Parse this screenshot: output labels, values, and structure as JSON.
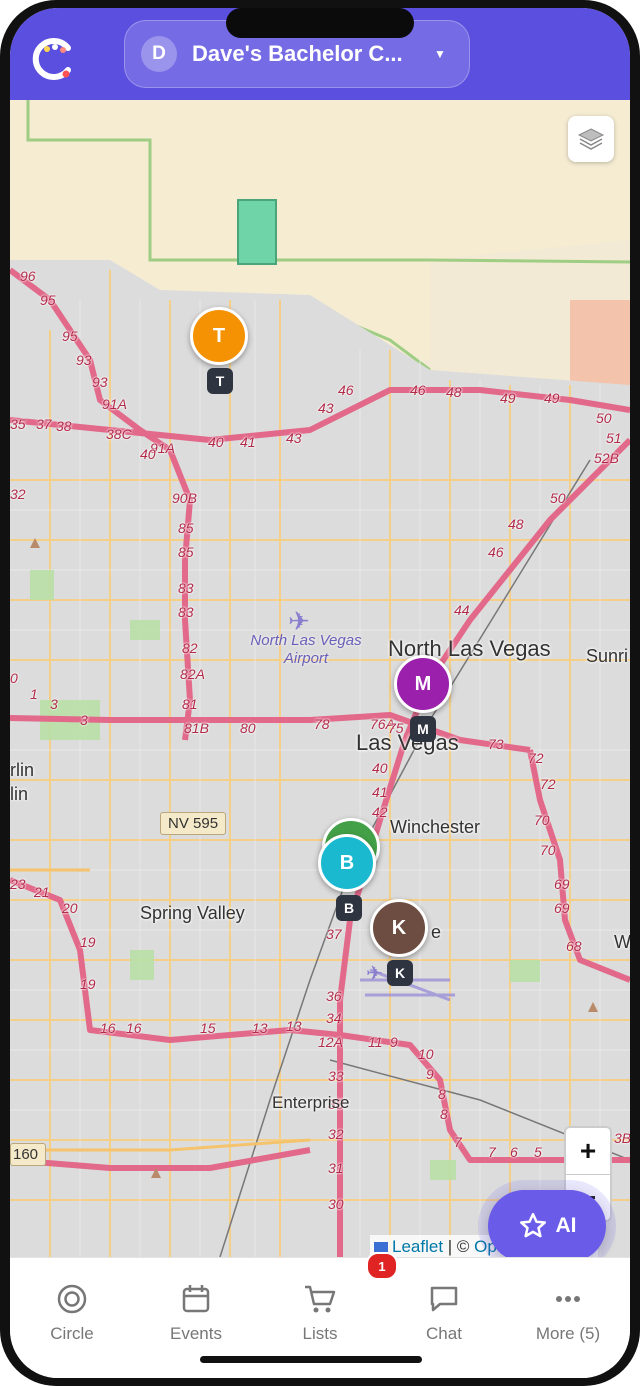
{
  "header": {
    "circle_initial": "D",
    "circle_name": "Dave's Bachelor C...",
    "dropdown_icon": "chevron-down-icon"
  },
  "map": {
    "places": {
      "north_las_vegas": "North Las Vegas",
      "las_vegas": "Las Vegas",
      "winchester": "Winchester",
      "spring_valley": "Spring Valley",
      "enterprise": "Enterprise",
      "sunrise_partial": "Sunri",
      "rlin_partial": "rlin",
      "lin_partial": "lin",
      "e_partial": "e",
      "w_partial": "W"
    },
    "airport": "North Las Vegas Airport",
    "shields": {
      "nv595": "NV 595",
      "r160": "160"
    },
    "route_numbers": [
      "96",
      "95",
      "95",
      "93",
      "93",
      "91A",
      "35",
      "37",
      "38",
      "38C",
      "91A",
      "40",
      "40",
      "41",
      "43",
      "43",
      "46",
      "46",
      "48",
      "49",
      "49",
      "50",
      "51",
      "52B",
      "50",
      "48",
      "46",
      "44",
      "32",
      "90B",
      "85",
      "85",
      "83",
      "83",
      "82",
      "82A",
      "81",
      "81B",
      "80",
      "78",
      "76A",
      "75",
      "73",
      "72",
      "72",
      "70",
      "70",
      "69",
      "69",
      "68",
      "40",
      "41",
      "42",
      "0",
      "1",
      "3",
      "3",
      "23",
      "21",
      "20",
      "19",
      "19",
      "16",
      "16",
      "15",
      "13",
      "13",
      "12A",
      "11",
      "9",
      "10",
      "9",
      "8",
      "8",
      "7",
      "7",
      "6",
      "5",
      "3B",
      "33",
      "33",
      "32",
      "31",
      "30",
      "34",
      "36",
      "37",
      "38"
    ],
    "markers": [
      {
        "letter": "T",
        "color": "#f59203"
      },
      {
        "letter": "M",
        "color": "#9b20ab"
      },
      {
        "letter": "B",
        "color": "#1ab9d0"
      },
      {
        "letter": "K",
        "color": "#6d4c41"
      }
    ],
    "hidden_marker_color": "#43a047",
    "zoom_in": "+",
    "zoom_out": "−",
    "ai_label": "AI",
    "attribution": {
      "leaflet": "Leaflet",
      "sep": " | © ",
      "osm": "OpenStreetMap"
    }
  },
  "tabs": [
    {
      "label": "Circle",
      "icon": "circle-target-icon"
    },
    {
      "label": "Events",
      "icon": "calendar-icon"
    },
    {
      "label": "Lists",
      "icon": "cart-icon",
      "badge": "1"
    },
    {
      "label": "Chat",
      "icon": "chat-icon"
    },
    {
      "label": "More (5)",
      "icon": "more-dots-icon"
    }
  ],
  "colors": {
    "header": "#5b4fe0",
    "accent": "#6a5be8",
    "roads": "#f4c36b",
    "highways": "#e2698a"
  }
}
